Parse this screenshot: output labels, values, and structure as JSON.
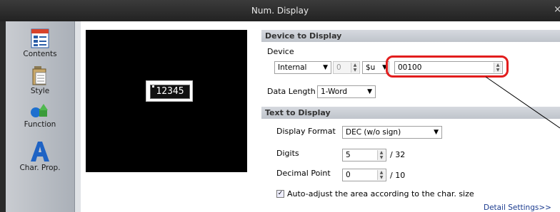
{
  "window": {
    "title": "Num. Display",
    "close_glyph": "×"
  },
  "sidebar": {
    "items": [
      {
        "label": "Contents",
        "icon": "contents-icon"
      },
      {
        "label": "Style",
        "icon": "style-icon"
      },
      {
        "label": "Function",
        "icon": "function-icon"
      },
      {
        "label": "Char. Prop.",
        "icon": "char-prop-icon"
      }
    ]
  },
  "preview": {
    "value": "12345"
  },
  "device_to_display": {
    "header": "Device to Display",
    "device_label": "Device",
    "device_type": "Internal",
    "station_value": "0",
    "prefix": "$u",
    "address_value": "00100",
    "data_length_label": "Data Length",
    "data_length_value": "1-Word"
  },
  "text_to_display": {
    "header": "Text to Display",
    "display_format_label": "Display Format",
    "display_format_value": "DEC (w/o sign)",
    "digits_label": "Digits",
    "digits_value": "5",
    "digits_max": "/ 32",
    "decimal_point_label": "Decimal Point",
    "decimal_point_value": "0",
    "decimal_point_max": "/ 10",
    "auto_adjust_label": "Auto-adjust the area according to the char. size",
    "auto_adjust_checked": true,
    "detail_settings_link": "Detail Settings>>"
  },
  "colors": {
    "highlight_ring": "#e21d1d",
    "titlebar": "#2e2e2e",
    "link": "#1b3b8f"
  }
}
